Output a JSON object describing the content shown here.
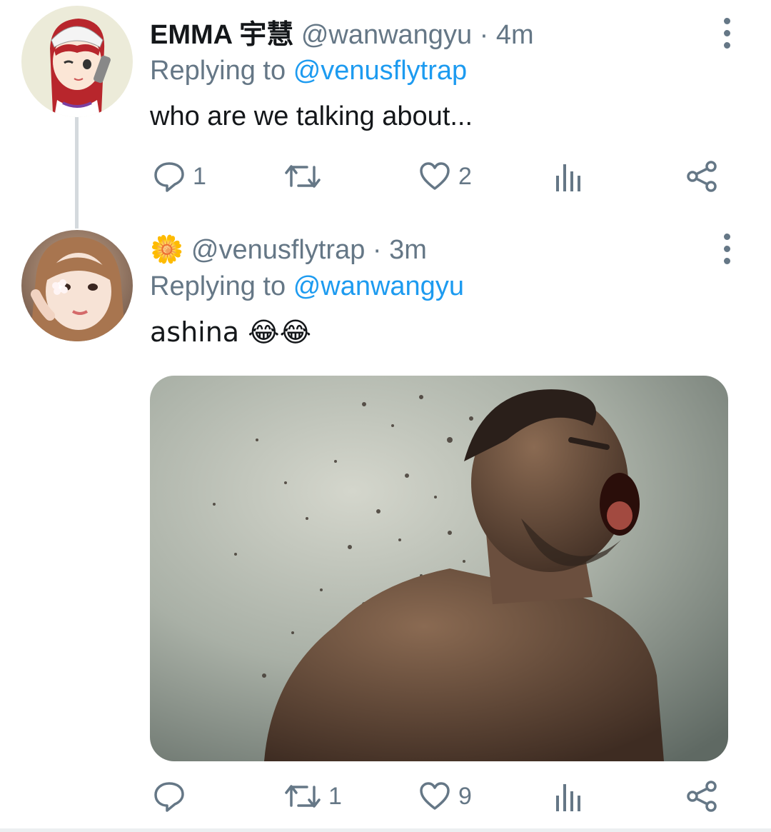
{
  "tweets": [
    {
      "display_name": "EMMA 宇慧",
      "handle": "@wanwangyu",
      "sep": "·",
      "time": "4m",
      "replying_prefix": "Replying to",
      "replying_to": "@venusflytrap",
      "text": "who are we talking about...",
      "counts": {
        "reply": "1",
        "retweet": "",
        "like": "2"
      },
      "avatar_icon": "anime-girl-avatar"
    },
    {
      "display_name": "🌼",
      "handle": "@venusflytrap",
      "sep": "·",
      "time": "3m",
      "replying_prefix": "Replying to",
      "replying_to": "@wanwangyu",
      "text": "ashina 😂😂",
      "counts": {
        "reply": "",
        "retweet": "1",
        "like": "9"
      },
      "avatar_icon": "girl-photo-avatar",
      "media_icon": "disintegrating-man-photo"
    }
  ],
  "colors": {
    "link": "#1d9bf0",
    "muted": "#657786",
    "thread_line": "#d4d9dd"
  }
}
